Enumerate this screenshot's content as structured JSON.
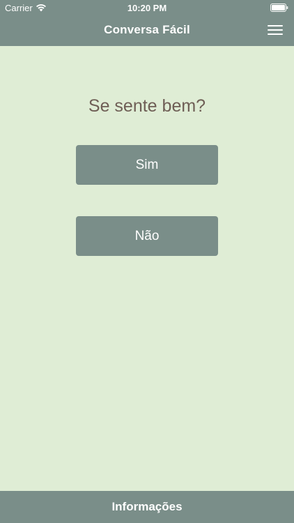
{
  "status_bar": {
    "carrier": "Carrier",
    "time": "10:20 PM",
    "wifi_icon": "wifi-icon",
    "battery_icon": "battery-icon"
  },
  "nav": {
    "title": "Conversa Fácil",
    "menu_icon": "hamburger-menu-icon"
  },
  "main": {
    "question": "Se sente bem?",
    "answers": [
      {
        "label": "Sim"
      },
      {
        "label": "Não"
      }
    ]
  },
  "bottom_bar": {
    "label": "Informações"
  },
  "colors": {
    "bar": "#7a8e89",
    "background": "#dfedd5",
    "question_text": "#6e5e55",
    "button_text": "#ffffff"
  }
}
